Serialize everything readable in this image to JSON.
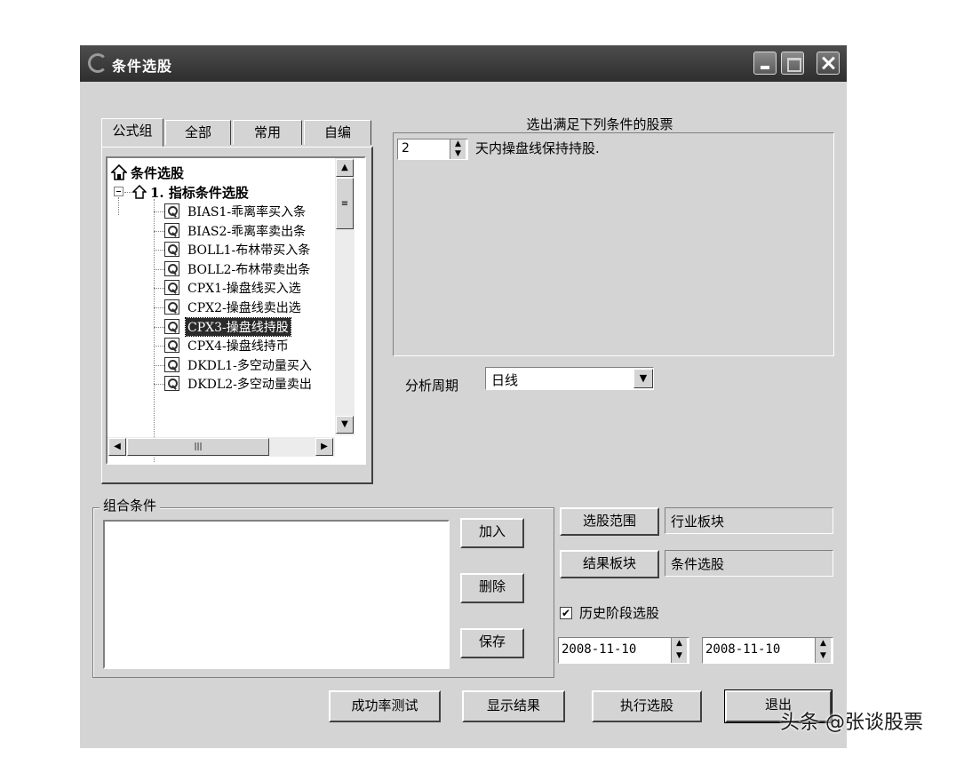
{
  "window": {
    "title": "条件选股"
  },
  "tabs": [
    "公式组",
    "全部",
    "常用",
    "自编"
  ],
  "tree": {
    "root": "条件选股",
    "group": "1. 指标条件选股",
    "items": [
      "BIAS1-乖离率买入条",
      "BIAS2-乖离率卖出条",
      "BOLL1-布林带买入条",
      "BOLL2-布林带卖出条",
      "CPX1-操盘线买入选",
      "CPX2-操盘线卖出选",
      "CPX3-操盘线持股",
      "CPX4-操盘线持币",
      "DKDL1-多空动量买入",
      "DKDL2-多空动量卖出"
    ],
    "selected_index": 6
  },
  "condition": {
    "header": "选出满足下列条件的股票",
    "days_value": "2",
    "text": "天内操盘线保持持股."
  },
  "period": {
    "label": "分析周期",
    "value": "日线"
  },
  "combo": {
    "label": "组合条件",
    "add": "加入",
    "delete": "删除",
    "save": "保存"
  },
  "scope": {
    "button": "选股范围",
    "value": "行业板块"
  },
  "result": {
    "button": "结果板块",
    "value": "条件选股"
  },
  "history": {
    "checked": true,
    "label": "历史阶段选股",
    "start": "2008-11-10",
    "end": "2008-11-10"
  },
  "actions": {
    "test": "成功率测试",
    "show": "显示结果",
    "run": "执行选股",
    "exit": "退出"
  },
  "watermark": "头条 @张谈股票",
  "icons": [
    "app-logo-icon",
    "minimize-icon",
    "maximize-icon",
    "close-icon",
    "home-icon",
    "collapse-icon",
    "formula-icon",
    "spin-icon",
    "dropdown-arrow-icon",
    "checkbox-icon"
  ]
}
